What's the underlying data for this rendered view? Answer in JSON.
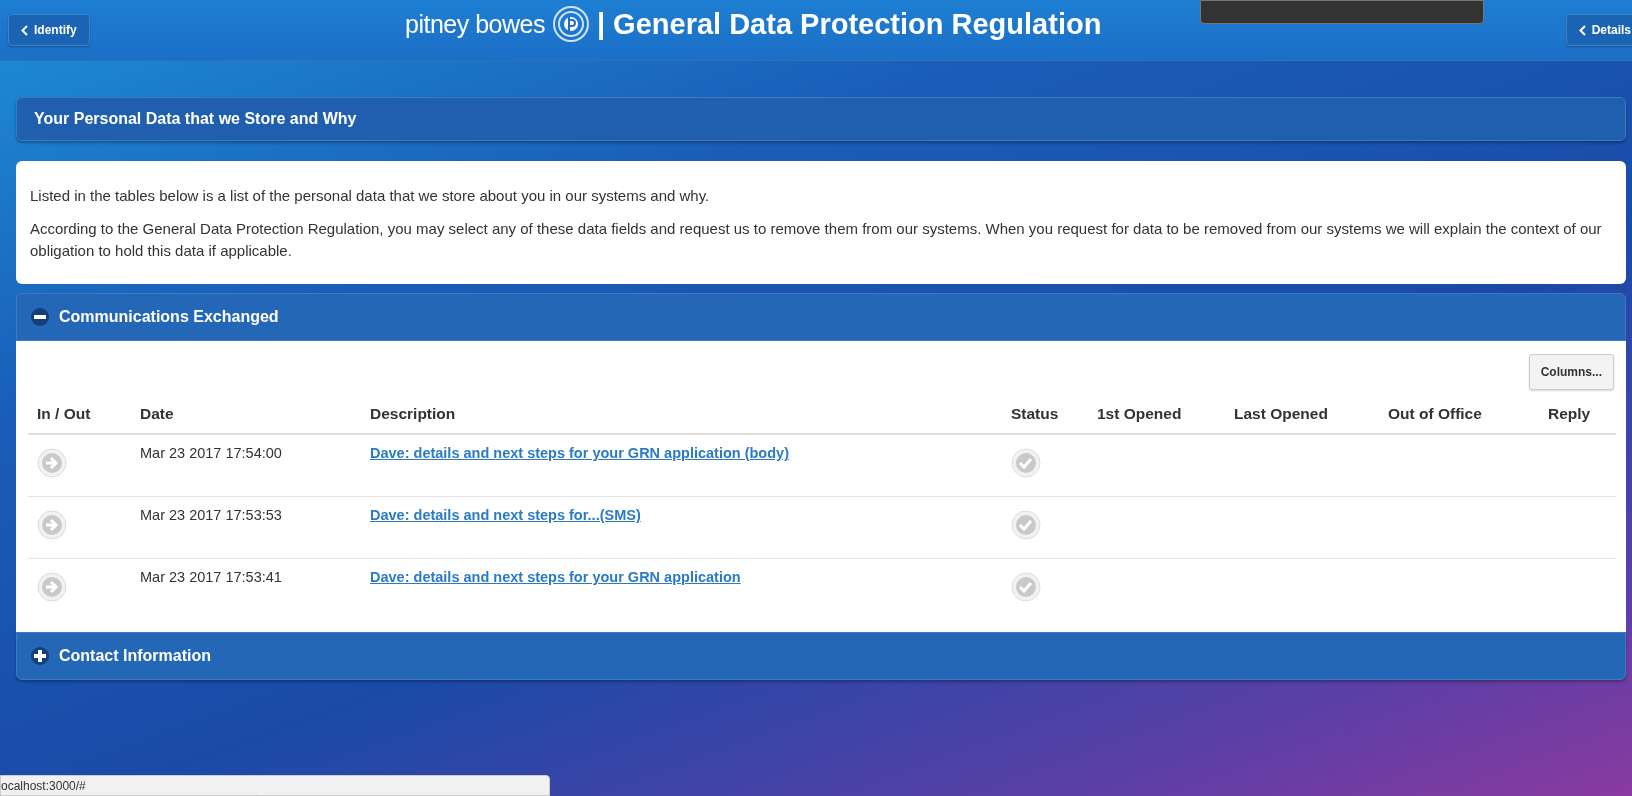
{
  "header": {
    "back_button": "Identify",
    "brand": "pitney bowes",
    "title": "| General Data Protection Regulation",
    "details_button": "Details"
  },
  "section_title": "Your Personal Data that we Store and Why",
  "intro": [
    "Listed in the tables below is a list of the personal data that we store about you in our systems and why.",
    "According to the General Data Protection Regulation, you may select any of these data fields and request us to remove them from our systems. When you request for data to be removed from our systems we will explain the context of our obligation to hold this data if applicable."
  ],
  "panels": [
    {
      "title": "Communications Exchanged",
      "expanded": true,
      "columns_button": "Columns...",
      "columns": [
        "In / Out",
        "Date",
        "Description",
        "Status",
        "1st Opened",
        "Last Opened",
        "Out of Office",
        "Reply"
      ],
      "rows": [
        {
          "date": "Mar 23 2017 17:54:00",
          "description": "Dave: details and next steps for your GRN application (body)"
        },
        {
          "date": "Mar 23 2017 17:53:53",
          "description": "Dave: details and next steps for...(SMS)"
        },
        {
          "date": "Mar 23 2017 17:53:41",
          "description": "Dave: details and next steps for your GRN application"
        }
      ]
    },
    {
      "title": "Contact Information",
      "expanded": false
    }
  ],
  "status_bar": "ocalhost:3000/#"
}
